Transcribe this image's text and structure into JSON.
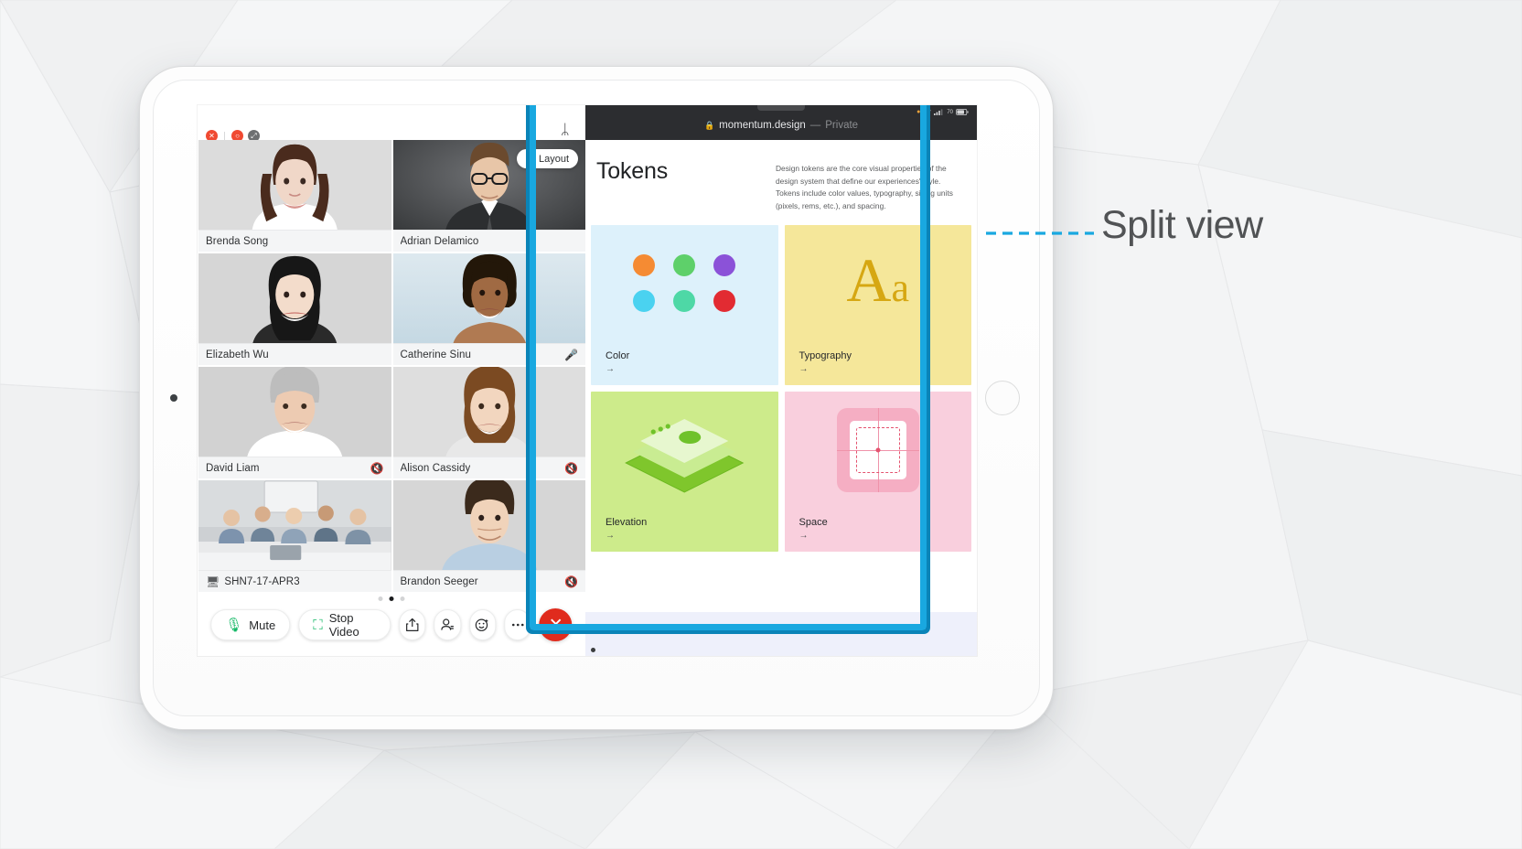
{
  "annotation": {
    "label": "Split view",
    "accent_color": "#19a8e0"
  },
  "device": {
    "name": "ipad-pro",
    "body_color": "#fdfdfd"
  },
  "video_call": {
    "window_controls": [
      {
        "name": "close-button",
        "color": "#f04a32",
        "glyph": "✕"
      },
      {
        "name": "minimize-button",
        "color": "#f04a32",
        "glyph": "○"
      },
      {
        "name": "fullscreen-button",
        "color": "#6d6f71",
        "glyph": "⤢"
      }
    ],
    "bluetooth_icon": "ᛦ",
    "layout_chip": {
      "label": "Layout",
      "icon": "⊞"
    },
    "participants": [
      {
        "name": "Brenda Song",
        "muted": false,
        "screen_share": false,
        "active_speaker": false,
        "skin": "#f0d7c8",
        "hair": "#4a2b1d",
        "bg": "#dcdcdc",
        "shirt": "#ffffff"
      },
      {
        "name": "Adrian Delamico",
        "muted": false,
        "screen_share": false,
        "active_speaker": false,
        "skin": "#e8c6a8",
        "hair": "#6b4a2e",
        "bg": "#4e5052",
        "shirt": "#2c2e30"
      },
      {
        "name": "Elizabeth Wu",
        "muted": false,
        "screen_share": false,
        "active_speaker": false,
        "skin": "#f3dccb",
        "hair": "#171717",
        "bg": "#d6d6d6",
        "shirt": "#1c1c1c"
      },
      {
        "name": "Catherine Sinu",
        "muted": false,
        "screen_share": false,
        "active_speaker": true,
        "skin": "#a06a43",
        "hair": "#231709",
        "bg": "#cfdfe8",
        "shirt": "#b07a52"
      },
      {
        "name": "David Liam",
        "muted": true,
        "screen_share": false,
        "active_speaker": false,
        "skin": "#edcbb2",
        "hair": "#bdbdbd",
        "bg": "#d2d2d2",
        "shirt": "#ffffff"
      },
      {
        "name": "Alison Cassidy",
        "muted": true,
        "screen_share": false,
        "active_speaker": false,
        "skin": "#f2d6bf",
        "hair": "#7b4a22",
        "bg": "#dedede",
        "shirt": "#e8e8e8"
      },
      {
        "name": "SHN7-17-APR3",
        "muted": false,
        "screen_share": true,
        "active_speaker": false,
        "skin": "#e8c9ad",
        "hair": "#4a3320",
        "bg": "#c9cbcd",
        "shirt": "#7d93ad"
      },
      {
        "name": "Brandon Seeger",
        "muted": true,
        "screen_share": false,
        "active_speaker": false,
        "skin": "#f0d3ba",
        "hair": "#3b2a1c",
        "bg": "#d6d6d6",
        "shirt": "#b9cfe2"
      }
    ],
    "pagination": {
      "pages": 3,
      "active_index": 1
    },
    "toolbar": [
      {
        "name": "mute-button",
        "label": "Mute",
        "icon": "microphone-icon",
        "icon_color": "#14b866"
      },
      {
        "name": "stop-video-button",
        "label": "Stop Video",
        "icon": "video-camera-icon",
        "icon_color": "#14b866"
      },
      {
        "name": "share-button",
        "label": "",
        "icon": "share-upload-icon"
      },
      {
        "name": "participants-button",
        "label": "",
        "icon": "participants-icon"
      },
      {
        "name": "reactions-button",
        "label": "",
        "icon": "smiley-plus-icon"
      },
      {
        "name": "more-button",
        "label": "",
        "icon": "ellipsis-icon"
      },
      {
        "name": "end-call-button",
        "label": "",
        "icon": "close-x-icon"
      }
    ]
  },
  "browser": {
    "url": "momentum.design",
    "separator": "—",
    "mode": "Private",
    "lock_icon": "🔒",
    "status_icons": [
      "●",
      "wifi",
      "▂▃▅",
      "battery"
    ]
  },
  "tokens_page": {
    "title": "Tokens",
    "description": "Design tokens are the core visual properties of the design system that define our experiences' style. Tokens include color values, typography, sizing units (pixels, rems, etc.), and spacing.",
    "arrow": "→",
    "cards": [
      {
        "label": "Color",
        "bg": "#ddf1fb",
        "swatches": [
          "#f58b33",
          "#5ed06a",
          "#8b52d8",
          "#4ad2f0",
          "#4ed8a6",
          "#e22b32"
        ]
      },
      {
        "label": "Typography",
        "bg": "#f5e79a",
        "glyph_upper": "A",
        "glyph_lower": "a",
        "glyph_color": "#d6a712"
      },
      {
        "label": "Elevation",
        "bg": "#cdeb8b",
        "accent": "#6fc22a"
      },
      {
        "label": "Space",
        "bg": "#f9cfdd",
        "accent": "#e4536f"
      }
    ]
  }
}
